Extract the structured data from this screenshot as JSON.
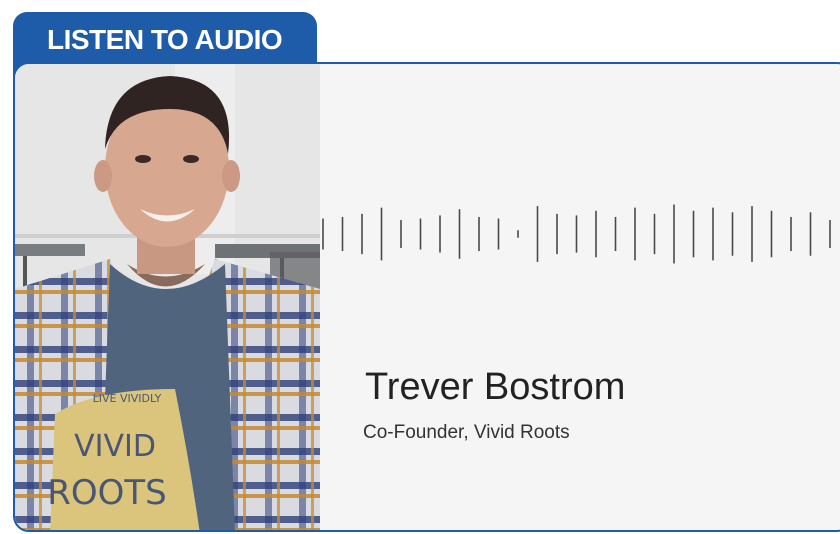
{
  "tab": {
    "label": "LISTEN TO AUDIO"
  },
  "speaker": {
    "name": "Trever Bostrom",
    "role": "Co-Founder, Vivid Roots"
  },
  "photo": {
    "shirt_line1": "VIVID",
    "shirt_line2": "ROOTS",
    "shirt_arc": "LIVE VIVIDLY"
  },
  "waveform": {
    "levels": [
      0.5,
      0.55,
      0.65,
      0.85,
      0.45,
      0.5,
      0.6,
      0.8,
      0.55,
      0.5,
      0.12,
      0.9,
      0.65,
      0.6,
      0.75,
      0.55,
      0.85,
      0.65,
      0.95,
      0.75,
      0.85,
      0.7,
      0.9,
      0.75,
      0.55,
      0.7,
      0.45,
      0.12,
      0.35,
      0.75,
      0.55,
      0.85
    ]
  },
  "colors": {
    "accent": "#1e5ba8",
    "card": "#f5f5f5",
    "text": "#222222",
    "wave": "#4a4a4a"
  }
}
